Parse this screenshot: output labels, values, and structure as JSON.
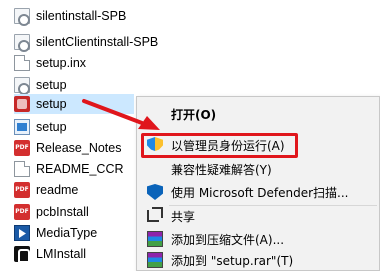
{
  "files": [
    {
      "name": "silentinstall-SPB",
      "icon": "settings-file-icon"
    },
    {
      "name": "silentClientinstall-SPB",
      "icon": "settings-file-icon"
    },
    {
      "name": "setup.inx",
      "icon": "blank-file-icon"
    },
    {
      "name": "setup",
      "icon": "settings-file-icon"
    },
    {
      "name": "setup",
      "icon": "setup-installer-icon",
      "selected": true
    },
    {
      "name": "setup",
      "icon": "setup-window-icon"
    },
    {
      "name": "Release_Notes",
      "icon": "pdf-icon"
    },
    {
      "name": "README_CCR",
      "icon": "blank-file-icon"
    },
    {
      "name": "readme",
      "icon": "pdf-icon"
    },
    {
      "name": "pcbInstall",
      "icon": "pdf-icon"
    },
    {
      "name": "MediaType",
      "icon": "media-file-icon"
    },
    {
      "name": "LMInstall",
      "icon": "lm-app-icon"
    }
  ],
  "context_menu": {
    "open": "打开(O)",
    "run_as_admin": "以管理员身份运行(A)",
    "compat_troubleshoot": "兼容性疑难解答(Y)",
    "defender_scan": "使用 Microsoft Defender扫描...",
    "share": "共享",
    "add_to_archive": "添加到压缩文件(A)...",
    "add_to_setup_rar": "添加到 \"setup.rar\"(T)"
  },
  "colors": {
    "annotation_red": "#e0161c",
    "selection_blue": "#cce8ff",
    "menu_background": "#f2f2f2"
  }
}
